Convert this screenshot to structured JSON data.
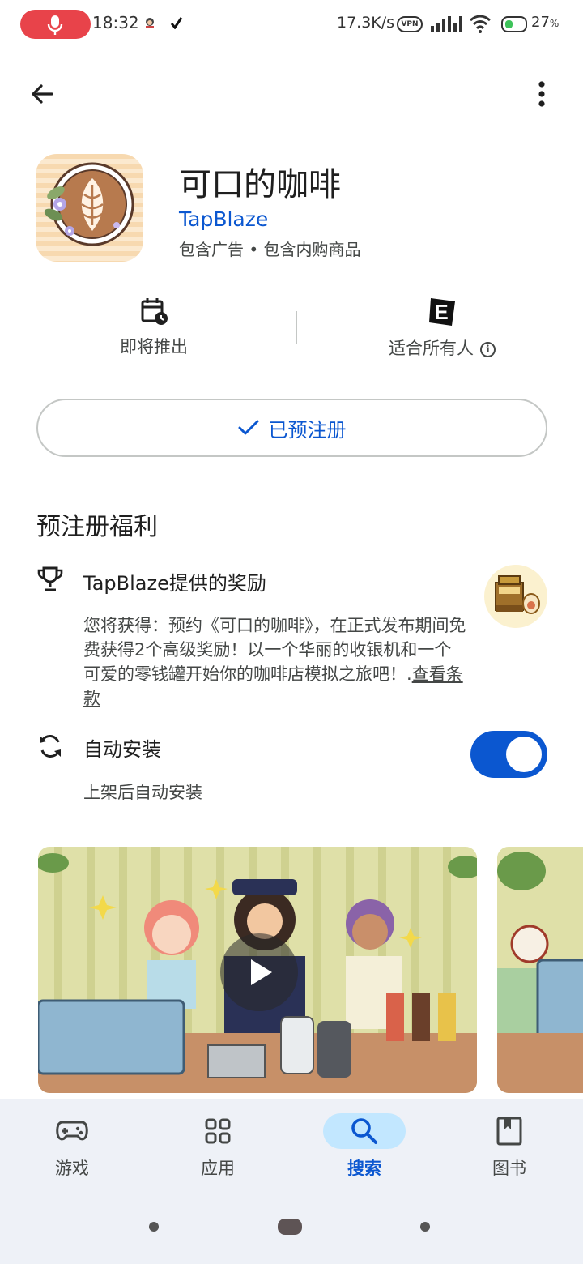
{
  "status_bar": {
    "time": "18:32",
    "network_speed": "17.3K/s",
    "vpn_label": "VPN",
    "battery_percent": "27",
    "battery_unit": "%",
    "recording_color": "#e8434a"
  },
  "app": {
    "title": "可口的咖啡",
    "developer": "TapBlaze",
    "meta": "包含广告 • 包含内购商品"
  },
  "info_row": {
    "release_label": "即将推出",
    "release_icon": "calendar-clock-icon",
    "rating_badge": "E",
    "rating_label": "适合所有人"
  },
  "prereg_button": {
    "label": "已预注册"
  },
  "rewards": {
    "section_title": "预注册福利",
    "reward_title": "TapBlaze提供的奖励",
    "reward_desc": "您将获得：预约《可口的咖啡》，在正式发布期间免费获得2个高级奖励！以一个华丽的收银机和一个可爱的零钱罐开始你的咖啡店模拟之旅吧！.",
    "terms_link": "查看条款"
  },
  "auto_install": {
    "title": "自动安装",
    "subtitle": "上架后自动安装",
    "enabled": true
  },
  "bottom_nav": {
    "items": [
      {
        "label": "游戏",
        "icon": "gamepad-icon",
        "active": false
      },
      {
        "label": "应用",
        "icon": "apps-grid-icon",
        "active": false
      },
      {
        "label": "搜索",
        "icon": "search-icon",
        "active": true
      },
      {
        "label": "图书",
        "icon": "book-icon",
        "active": false
      }
    ]
  },
  "colors": {
    "accent": "#0b57d0",
    "nav_active_pill": "#c2e7ff",
    "nav_background": "#eef1f7"
  }
}
